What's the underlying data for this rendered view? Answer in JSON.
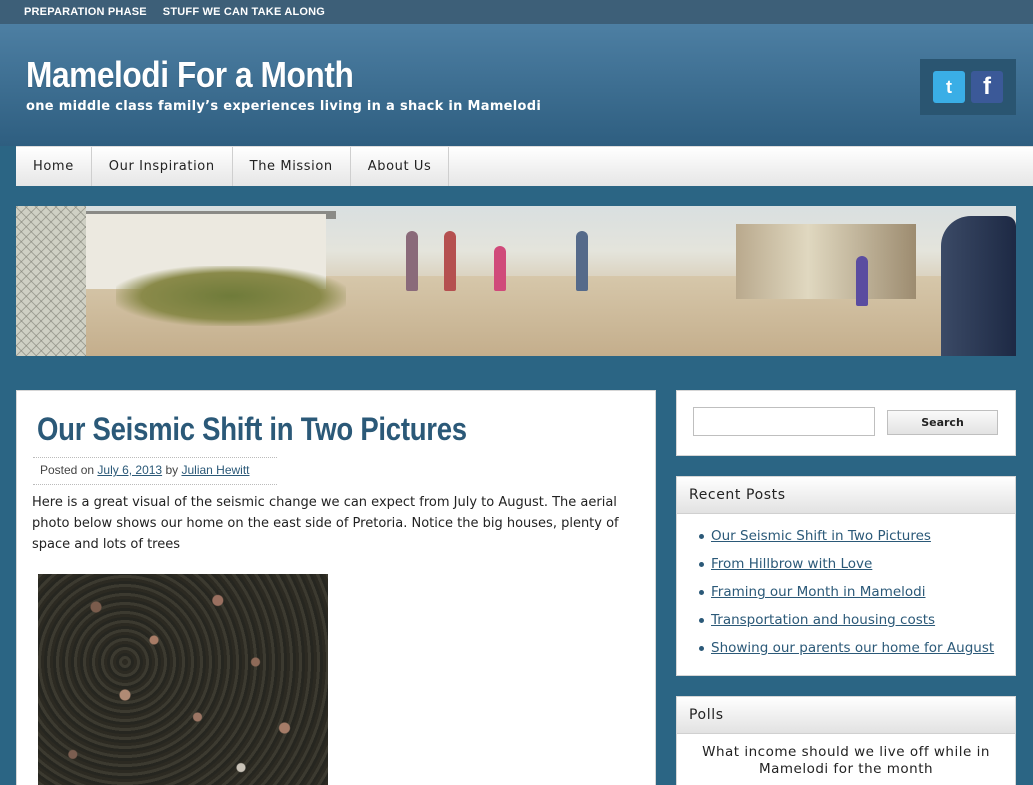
{
  "topbar": {
    "links": [
      "PREPARATION PHASE",
      "STUFF WE CAN TAKE ALONG"
    ]
  },
  "header": {
    "title": "Mamelodi For a Month",
    "tagline": "one middle class family’s experiences living in a shack in Mamelodi",
    "social": {
      "twitter": "t",
      "facebook": "f"
    }
  },
  "nav": {
    "items": [
      "Home",
      "Our Inspiration",
      "The Mission",
      "About Us"
    ]
  },
  "post": {
    "title": "Our Seismic Shift in Two Pictures",
    "meta_prefix": "Posted on",
    "date": "July 6, 2013",
    "meta_by": "by",
    "author": "Julian Hewitt",
    "body": "Here is a great visual of the seismic change we can expect from July to August. The aerial photo below shows our home on the east side of Pretoria. Notice the big houses, plenty of space and lots of trees"
  },
  "search": {
    "button": "Search",
    "placeholder": ""
  },
  "recent_posts": {
    "heading": "Recent Posts",
    "items": [
      "Our Seismic Shift in Two Pictures",
      "From Hillbrow with Love",
      "Framing our Month in Mamelodi",
      "Transportation and housing costs",
      "Showing our parents our home for August"
    ]
  },
  "polls": {
    "heading": "Polls",
    "question": "What income should we live off while in Mamelodi for the month"
  },
  "colors": {
    "page_bg": "#2b6584",
    "header_bg": "#3d6f93",
    "link": "#2b5978"
  }
}
